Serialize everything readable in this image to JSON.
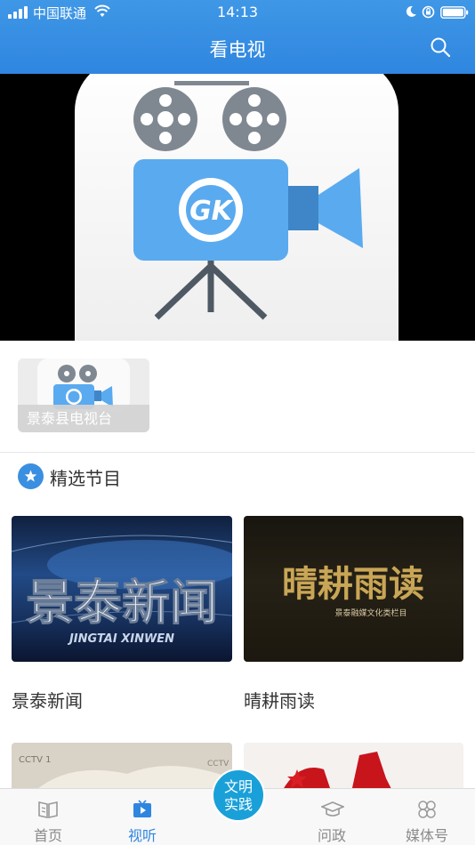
{
  "status": {
    "carrier": "中国联通",
    "time": "14:13"
  },
  "nav": {
    "title": "看电视"
  },
  "hero": {
    "logo_text": "GK"
  },
  "channels": [
    {
      "label": "景泰县电视台"
    }
  ],
  "section": {
    "title": "精选节目"
  },
  "programs": [
    {
      "title": "景泰新闻",
      "thumb_text": "景泰新闻",
      "thumb_sub": "JINGTAI XINWEN"
    },
    {
      "title": "晴耕雨读",
      "thumb_text": "晴耕雨读",
      "thumb_sub": "景泰融媒文化类栏目"
    },
    {
      "title": "",
      "thumb_text": "CCTV 1",
      "thumb_sub": "CCTV"
    },
    {
      "title": "",
      "thumb_text": "",
      "thumb_sub": ""
    }
  ],
  "tabbar": {
    "tabs": [
      {
        "label": "首页",
        "icon": "book-icon"
      },
      {
        "label": "视听",
        "icon": "tv-play-icon"
      },
      {
        "label": "问政",
        "icon": "graduation-cap-icon"
      },
      {
        "label": "媒体号",
        "icon": "clover-icon"
      }
    ],
    "center_line1": "文明",
    "center_line2": "实践"
  },
  "colors": {
    "accent": "#2f86df",
    "center_button": "#1aa0d8",
    "camera": "#5aaaf0",
    "reel": "#7f8891"
  }
}
